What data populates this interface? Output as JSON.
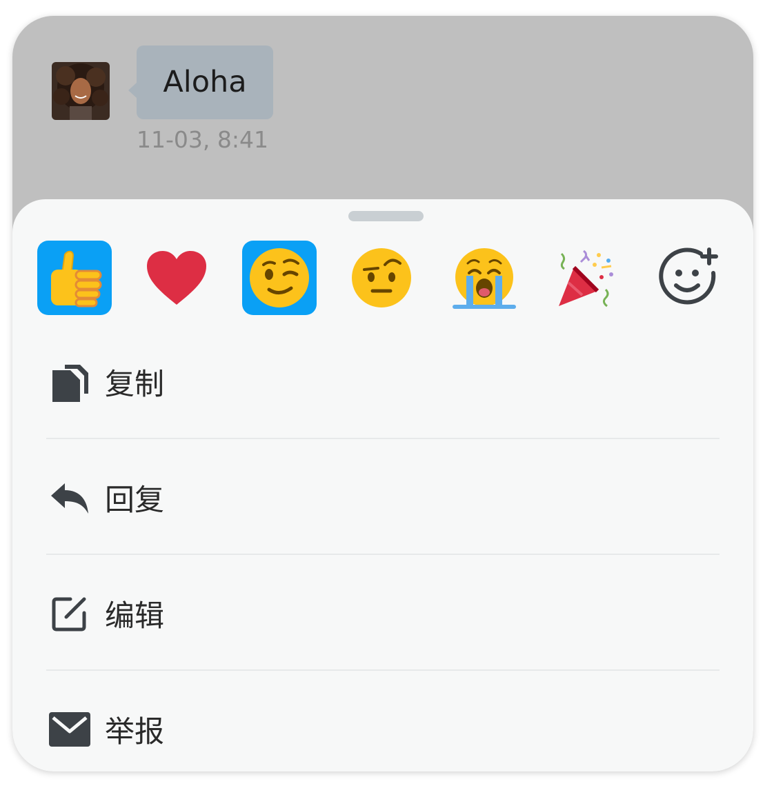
{
  "message": {
    "text": "Aloha",
    "timestamp": "11-03, 8:41",
    "sender_avatar": "avatar-photo"
  },
  "reactions": [
    {
      "name": "thumbs-up",
      "selected": true
    },
    {
      "name": "red-heart",
      "selected": false
    },
    {
      "name": "winking-face",
      "selected": true
    },
    {
      "name": "face-with-raised-eyebrow",
      "selected": false
    },
    {
      "name": "loudly-crying-face",
      "selected": false
    },
    {
      "name": "party-popper",
      "selected": false
    },
    {
      "name": "add-reaction",
      "selected": false
    }
  ],
  "menu": [
    {
      "label": "复制",
      "icon": "copy-icon"
    },
    {
      "label": "回复",
      "icon": "reply-icon"
    },
    {
      "label": "编辑",
      "icon": "edit-icon"
    },
    {
      "label": "举报",
      "icon": "report-envelope-icon"
    }
  ],
  "colors": {
    "accent": "#0aa0f5",
    "backdrop": "#bfbfbf",
    "sheet": "#f7f8f8",
    "bubble": "#a9b3bb"
  }
}
